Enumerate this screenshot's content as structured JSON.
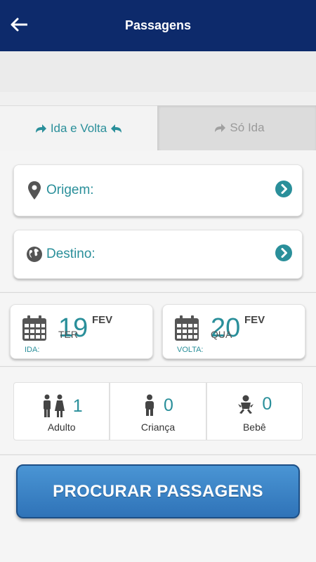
{
  "appbar": {
    "title": "Passagens",
    "back_icon": "arrow-left-icon"
  },
  "tabs": [
    {
      "label": "Ida e Volta",
      "active": true
    },
    {
      "label": "Só Ida",
      "active": false
    }
  ],
  "origin": {
    "label": "Origem:",
    "icon": "map-pin-icon"
  },
  "destination": {
    "label": "Destino:",
    "icon": "globe-icon"
  },
  "dates": {
    "ida": {
      "day": "19",
      "weekday": "TER",
      "month": "FEV",
      "tag": "IDA:"
    },
    "volta": {
      "day": "20",
      "weekday": "QUA",
      "month": "FEV",
      "tag": "VOLTA:"
    }
  },
  "passengers": [
    {
      "count": "1",
      "label": "Adulto",
      "icon": "adult-couple-icon"
    },
    {
      "count": "0",
      "label": "Criança",
      "icon": "child-icon"
    },
    {
      "count": "0",
      "label": "Bebê",
      "icon": "baby-icon"
    }
  ],
  "search_button": {
    "label": "PROCURAR PASSAGENS"
  },
  "colors": {
    "appbar": "#0d2a6b",
    "accent": "#2a8f9a",
    "button": "#3a84c8"
  }
}
